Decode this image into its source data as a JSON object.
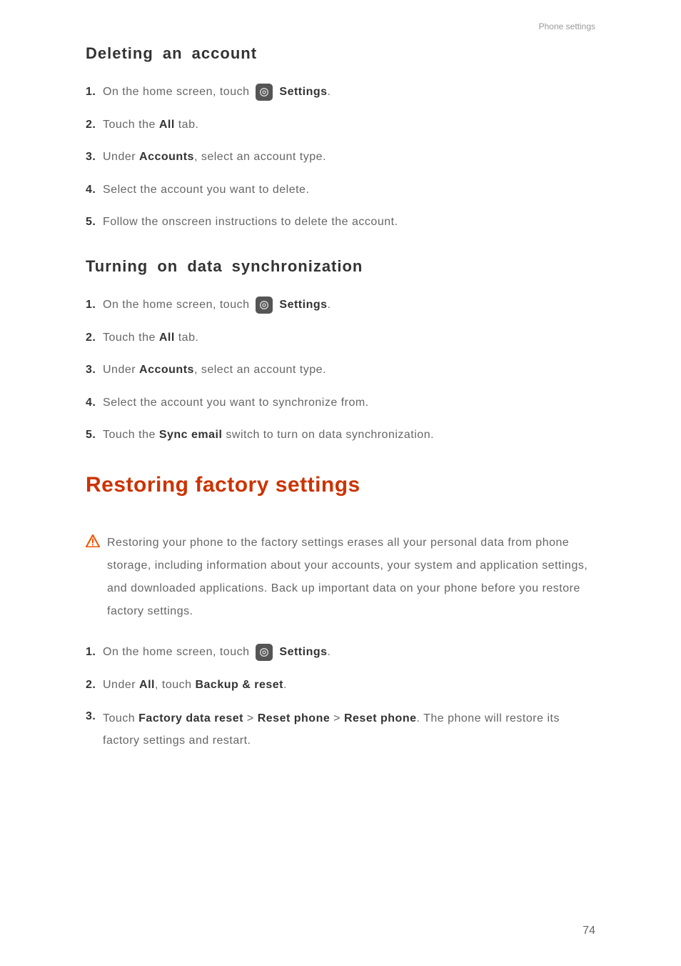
{
  "header": {
    "label": "Phone settings"
  },
  "section1": {
    "heading": "Deleting an account",
    "steps": {
      "s1": {
        "num": "1.",
        "pre": "On the home screen, touch ",
        "settings": "Settings",
        "post": "."
      },
      "s2": {
        "num": "2.",
        "pre": "Touch the ",
        "bold": "All",
        "post": " tab."
      },
      "s3": {
        "num": "3.",
        "pre": "Under ",
        "bold": "Accounts",
        "post": ", select an account type."
      },
      "s4": {
        "num": "4.",
        "text": "Select the account you want to delete."
      },
      "s5": {
        "num": "5.",
        "text": "Follow the onscreen instructions to delete the account."
      }
    }
  },
  "section2": {
    "heading": "Turning on data synchronization",
    "steps": {
      "s1": {
        "num": "1.",
        "pre": "On the home screen, touch ",
        "settings": "Settings",
        "post": "."
      },
      "s2": {
        "num": "2.",
        "pre": "Touch the ",
        "bold": "All",
        "post": " tab."
      },
      "s3": {
        "num": "3.",
        "pre": "Under ",
        "bold": "Accounts",
        "post": ", select an account type."
      },
      "s4": {
        "num": "4.",
        "text": "Select the account you want to synchronize from."
      },
      "s5": {
        "num": "5.",
        "pre": "Touch the ",
        "bold": "Sync email",
        "post": " switch to turn on data synchronization."
      }
    }
  },
  "section3": {
    "heading": "Restoring factory settings",
    "warning": "Restoring your phone to the factory settings erases all your personal data from phone storage, including information about your accounts, your system and application settings, and downloaded applications. Back up important data on your phone before you restore factory settings.",
    "steps": {
      "s1": {
        "num": "1.",
        "pre": "On the home screen, touch ",
        "settings": "Settings",
        "post": "."
      },
      "s2": {
        "num": "2.",
        "pre": "Under ",
        "bold1": "All",
        "mid": ", touch ",
        "bold2": "Backup & reset",
        "post": "."
      },
      "s3": {
        "num": "3.",
        "pre": "Touch ",
        "bold1": "Factory data reset",
        "sep1": " > ",
        "bold2": "Reset phone",
        "sep2": " > ",
        "bold3": "Reset phone",
        "post": ". The phone will restore its factory settings and restart."
      }
    }
  },
  "pageNumber": "74"
}
